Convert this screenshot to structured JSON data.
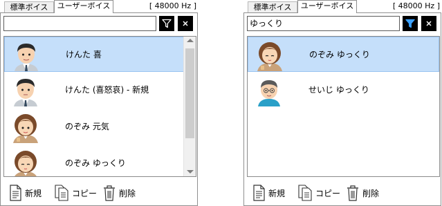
{
  "left": {
    "tabs": [
      "標準ボイス",
      "ユーザーボイス"
    ],
    "active_tab": 1,
    "sample_rate": "[ 48000 Hz ]",
    "search": {
      "value": ""
    },
    "items": [
      {
        "name": "けんた 喜",
        "face": "kenta",
        "selected": true
      },
      {
        "name": "けんた (喜怒哀) - 新規",
        "face": "kenta",
        "selected": false
      },
      {
        "name": "のぞみ 元気",
        "face": "nozomi",
        "selected": false
      },
      {
        "name": "のぞみ ゆっくり",
        "face": "nozomi",
        "selected": false
      }
    ],
    "footer": {
      "new": "新規",
      "copy": "コピー",
      "delete": "削除"
    }
  },
  "right": {
    "tabs": [
      "標準ボイス",
      "ユーザーボイス"
    ],
    "active_tab": 1,
    "sample_rate": "[ 48000 Hz ]",
    "search": {
      "value": "ゆっくり"
    },
    "items": [
      {
        "name": "のぞみ ゆっくり",
        "face": "nozomi",
        "selected": true
      },
      {
        "name": "せいじ ゆっくり",
        "face": "seiji",
        "selected": false
      }
    ],
    "footer": {
      "new": "新規",
      "copy": "コピー",
      "delete": "削除"
    }
  },
  "icons": {
    "filter": "filter-icon",
    "clear": "close-icon",
    "new": "new-document-icon",
    "copy": "copy-document-icon",
    "delete": "trash-icon"
  },
  "colors": {
    "selected_row": "#c5dffa",
    "button_bg": "#000000"
  }
}
